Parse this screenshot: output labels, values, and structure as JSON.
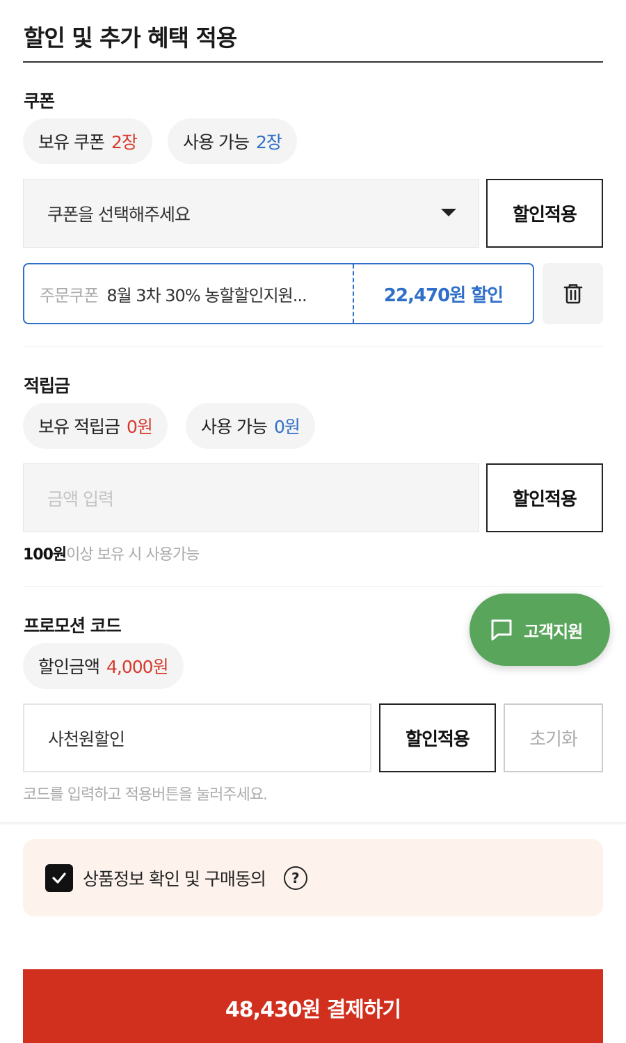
{
  "title": "할인 및 추가 혜택 적용",
  "coupon": {
    "label": "쿠폰",
    "owned_label": "보유 쿠폰",
    "owned_value": "2장",
    "usable_label": "사용 가능",
    "usable_value": "2장",
    "select_placeholder": "쿠폰을 선택해주세요",
    "apply_label": "할인적용",
    "applied": {
      "type": "주문쿠폰",
      "name": "8월 3차 30% 농할할인지원...",
      "discount": "22,470원 할인"
    }
  },
  "points": {
    "label": "적립금",
    "owned_label": "보유 적립금",
    "owned_value": "0원",
    "usable_label": "사용 가능",
    "usable_value": "0원",
    "input_placeholder": "금액 입력",
    "apply_label": "할인적용",
    "hint_strong": "100원",
    "hint_rest": "이상 보유 시 사용가능"
  },
  "promo": {
    "label": "프로모션 코드",
    "discount_label": "할인금액",
    "discount_value": "4,000원",
    "code_value": "사천원할인",
    "apply_label": "할인적용",
    "reset_label": "초기화",
    "hint": "코드를 입력하고 적용버튼을 눌러주세요."
  },
  "support": {
    "label": "고객지원"
  },
  "agree": {
    "label": "상품정보 확인 및 구매동의",
    "help": "?",
    "checked": true
  },
  "pay": {
    "label": "48,430원 결제하기"
  },
  "colors": {
    "accent_red": "#d1301f",
    "accent_blue": "#2f6fc9",
    "support_green": "#5aa55c"
  },
  "icons": [
    "caret-down-icon",
    "trash-icon",
    "chat-icon",
    "check-icon",
    "help-icon"
  ]
}
